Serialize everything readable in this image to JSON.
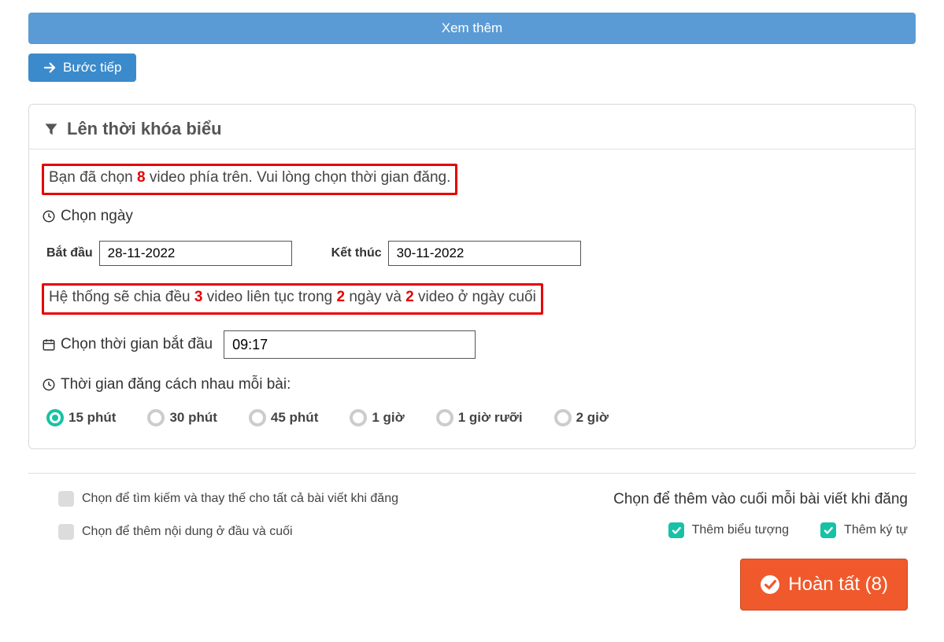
{
  "top": {
    "view_more": "Xem thêm",
    "next_step": "Bước tiếp"
  },
  "panel": {
    "title": "Lên thời khóa biểu",
    "info1_pre": "Bạn đã chọn ",
    "info1_count": "8",
    "info1_post": " video phía trên. Vui lòng chọn thời gian đăng.",
    "choose_day": "Chọn ngày",
    "start_label": "Bắt đầu",
    "start_value": "28-11-2022",
    "end_label": "Kết thúc",
    "end_value": "30-11-2022",
    "info2_a": "Hệ thống sẽ chia đều ",
    "info2_n1": "3",
    "info2_b": " video liên tục trong ",
    "info2_n2": "2",
    "info2_c": " ngày và ",
    "info2_n3": "2",
    "info2_d": " video ở ngày cuối",
    "start_time_label": "Chọn thời gian bắt đầu",
    "start_time_value": "09:17",
    "interval_label": "Thời gian đăng cách nhau mỗi bài:",
    "intervals": {
      "opt15": "15 phút",
      "opt30": "30 phút",
      "opt45": "45 phút",
      "opt1h": "1 giờ",
      "opt1h30": "1 giờ rưỡi",
      "opt2h": "2 giờ"
    }
  },
  "bottom": {
    "left1": "Chọn để tìm kiếm và thay thế cho tất cả bài viết khi đăng",
    "left2": "Chọn để thêm nội dung ở đầu và cuối",
    "right_title": "Chọn để thêm vào cuối mỗi bài viết khi đăng",
    "right_opt1": "Thêm biểu tượng",
    "right_opt2": "Thêm ký tự",
    "finish_label": "Hoàn tất (8)"
  }
}
